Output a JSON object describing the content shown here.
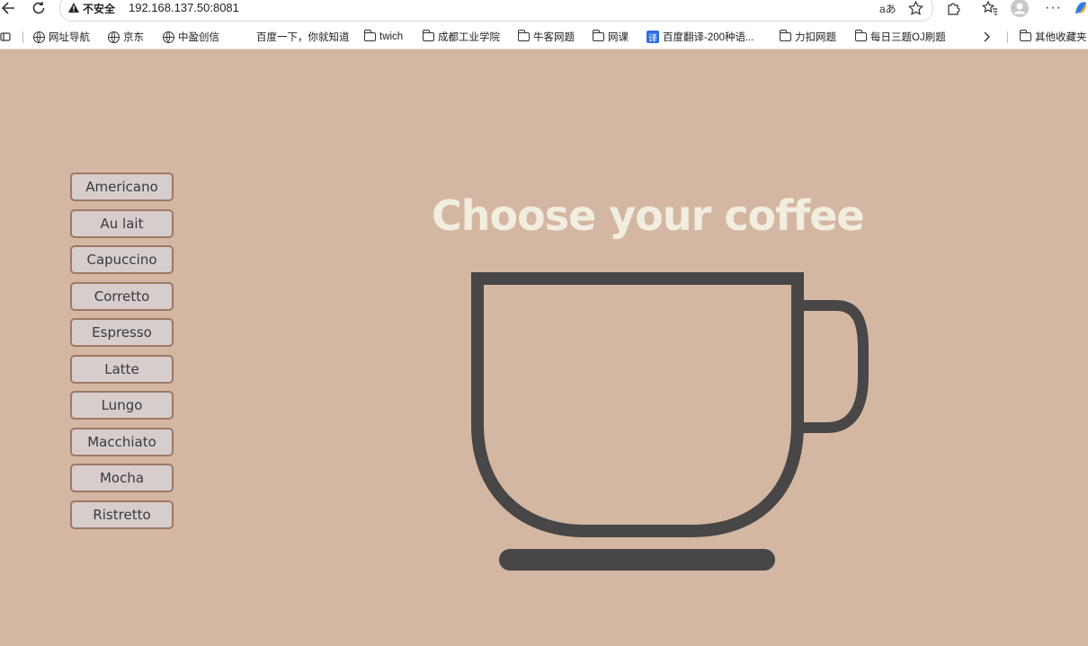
{
  "browser": {
    "security_label": "不安全",
    "url": "192.168.137.50:8081",
    "bookmarks": [
      {
        "label": "网址导航",
        "icon": "globe-icon"
      },
      {
        "label": "京东",
        "icon": "globe-icon"
      },
      {
        "label": "中盈创信",
        "icon": "globe-icon"
      },
      {
        "label": "百度一下，你就知道",
        "icon": ""
      },
      {
        "label": "twich",
        "icon": "folder-icon"
      },
      {
        "label": "成都工业学院",
        "icon": "folder-icon"
      },
      {
        "label": "牛客网题",
        "icon": "folder-icon"
      },
      {
        "label": "网课",
        "icon": "folder-icon"
      },
      {
        "label": "百度翻译-200种语...",
        "icon": "translate-icon"
      },
      {
        "label": "力扣网题",
        "icon": "folder-icon"
      },
      {
        "label": "每日三题OJ刷题",
        "icon": "folder-icon"
      }
    ],
    "other_bookmarks": "其他收藏夹",
    "read_aloud": "aあ"
  },
  "page": {
    "title": "Choose your coffee",
    "coffees": [
      "Americano",
      "Au lait",
      "Capuccino",
      "Corretto",
      "Espresso",
      "Latte",
      "Lungo",
      "Macchiato",
      "Mocha",
      "Ristretto"
    ]
  },
  "colors": {
    "background": "#d4b7a2",
    "title": "#f2eedf",
    "button_bg": "#d6cdcc",
    "button_border": "#9e7866",
    "cup_stroke": "#484646"
  }
}
